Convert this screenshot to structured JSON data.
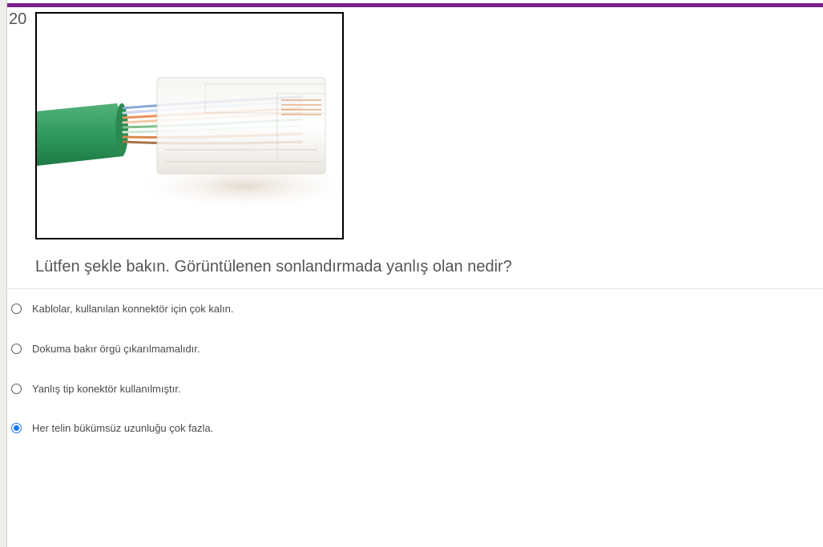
{
  "question": {
    "number": "20",
    "text": "Lütfen şekle bakın. Görüntülenen sonlandırmada yanlış olan nedir?",
    "figure_alt": "cable-connector-image"
  },
  "colors": {
    "accent_bar": "#7b1f8a",
    "radio_checked": "#1a73e8"
  },
  "options": [
    {
      "label": "Kablolar, kullanılan konnektör için çok kalın.",
      "selected": false
    },
    {
      "label": "Dokuma bakır örgü çıkarılmamalıdır.",
      "selected": false
    },
    {
      "label": "Yanlış tip konektör kullanılmıştır.",
      "selected": false
    },
    {
      "label": "Her telin bükümsüz uzunluğu çok fazla.",
      "selected": true
    }
  ]
}
